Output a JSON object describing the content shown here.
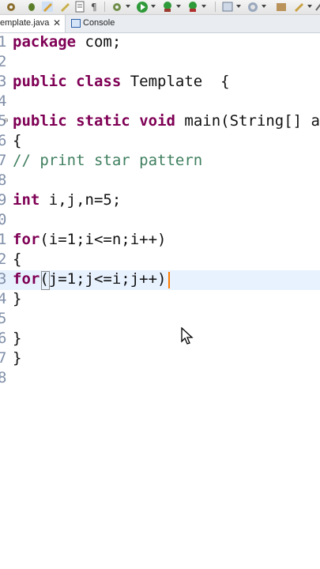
{
  "tabs": {
    "editor_label": "emplate.java",
    "editor_close": "✕",
    "console_label": "Console"
  },
  "toolbar": {
    "icons": [
      "settings-icon",
      "debug-icon",
      "run-icon",
      "external-tools-icon",
      "new-class-icon",
      "search-icon",
      "navigate-icon",
      "edit-icon"
    ]
  },
  "editor": {
    "gutter": [
      "1",
      "2",
      "3",
      "4",
      "5",
      "6",
      "7",
      "8",
      "9",
      "0",
      "1",
      "2",
      "3",
      "4",
      "5",
      "6",
      "7",
      "8"
    ],
    "fold_marker": "⊖",
    "lines": {
      "l1_kw": "package",
      "l1_rest": " com;",
      "l3_kw1": "public",
      "l3_kw2": "class",
      "l3_rest": " Template  {",
      "l5_kw1": "public",
      "l5_kw2": "static",
      "l5_kw3": "void",
      "l5_rest": " main(String[] a",
      "l6": "{",
      "l7_comment": "// print star pattern",
      "l9_kw": "int",
      "l9_rest": " i,j,n=5;",
      "l11_kw": "for",
      "l11_rest": "(i=1;i<=n;i++)",
      "l12": "{",
      "l13_kw": "for",
      "l13_rest": "(j=1;j<=i;j++)",
      "l14": "}",
      "l16": "}",
      "l17": "}"
    }
  }
}
